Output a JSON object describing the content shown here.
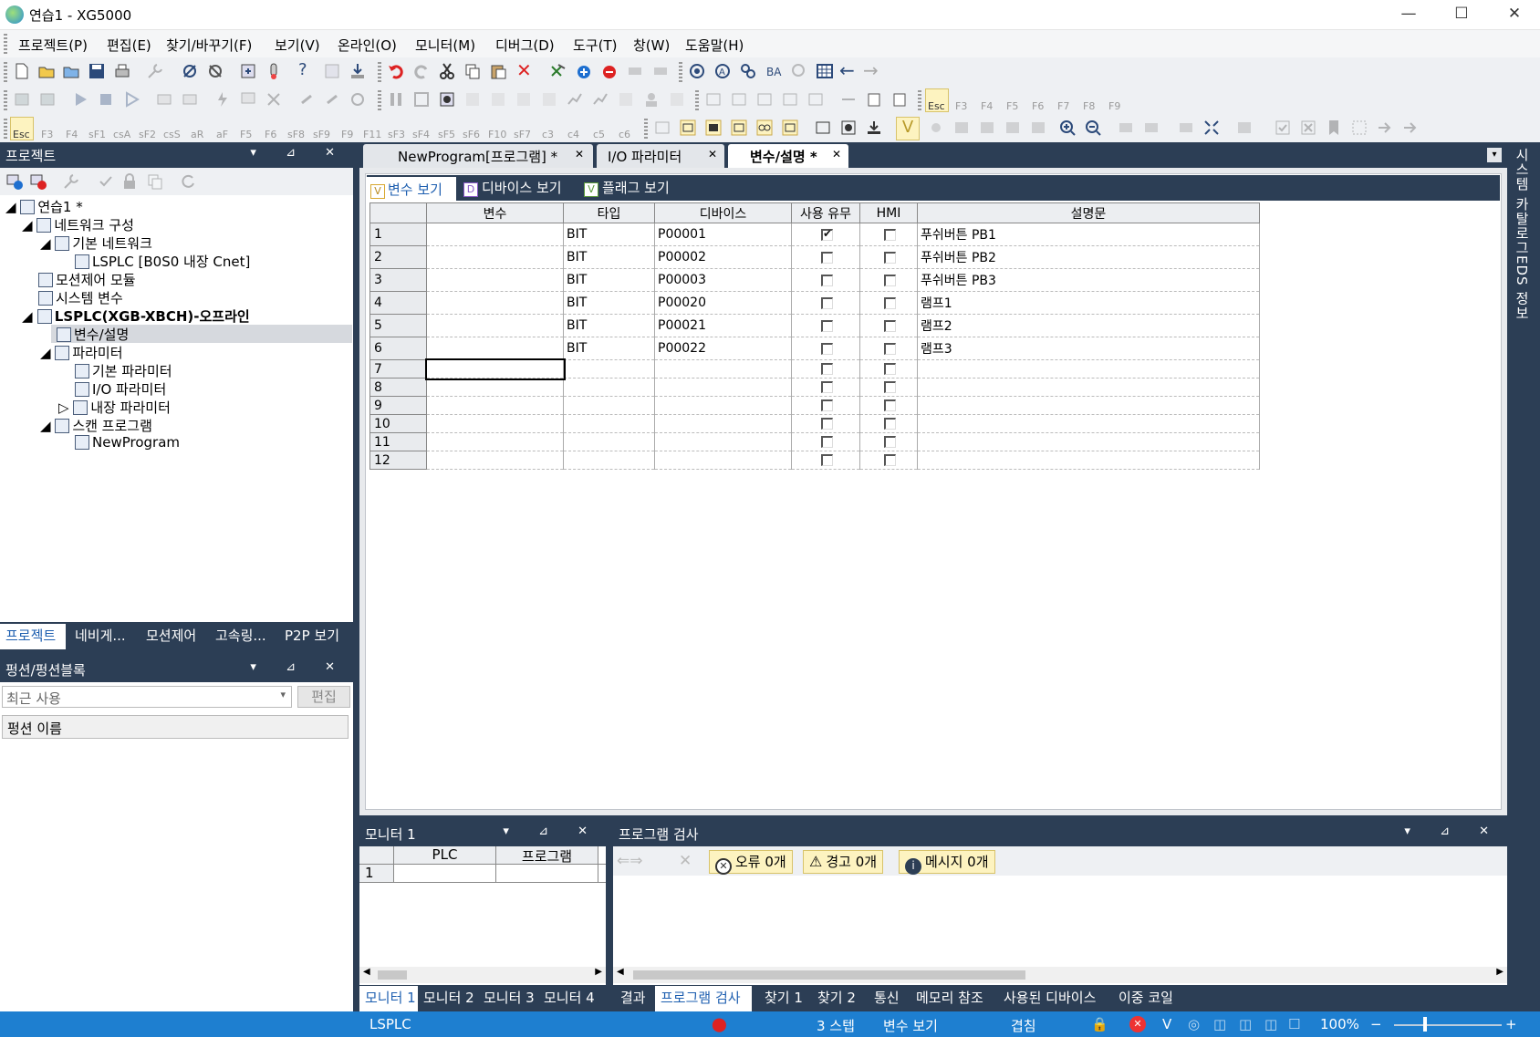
{
  "window": {
    "title": "연습1 - XG5000"
  },
  "menu": [
    "프로젝트(P)",
    "편집(E)",
    "찾기/바꾸기(F)",
    "보기(V)",
    "온라인(O)",
    "모니터(M)",
    "디버그(D)",
    "도구(T)",
    "창(W)",
    "도움말(H)"
  ],
  "toolbar": {
    "fkeys_row2": [
      "Esc",
      "F3",
      "F4",
      "F5",
      "F6",
      "F7",
      "F8",
      "F9"
    ],
    "fkeys_row3": [
      "Esc",
      "F3",
      "F4",
      "sF1",
      "csA",
      "sF2",
      "csS",
      "aR",
      "aF",
      "F5",
      "F6",
      "sF8",
      "sF9",
      "F9",
      "F11",
      "sF3",
      "sF4",
      "sF5",
      "sF6",
      "F10",
      "sF7",
      "c3",
      "c4",
      "c5",
      "c6"
    ]
  },
  "project_panel": {
    "title": "프로젝트",
    "tree": {
      "root": "연습1 *",
      "network": "네트워크 구성",
      "basic_network": "기본 네트워크",
      "cnet": "LSPLC [B0S0 내장 Cnet]",
      "motion": "모션제어 모듈",
      "system_vars": "시스템 변수",
      "plc": "LSPLC(XGB-XBCH)-오프라인",
      "vars": "변수/설명",
      "params": "파라미터",
      "basic_param": "기본 파라미터",
      "io_param": "I/O 파라미터",
      "builtin_param": "내장 파라미터",
      "scan_program": "스캔 프로그램",
      "new_program": "NewProgram"
    },
    "tabs": [
      "프로젝트",
      "네비게...",
      "모션제어",
      "고속링...",
      "P2P 보기"
    ]
  },
  "function_panel": {
    "title": "펑션/펑션블록",
    "combo_value": "최근 사용",
    "edit_button": "편집",
    "column": "펑션 이름"
  },
  "doc_tabs": [
    "NewProgram[프로그램] *",
    "I/O 파라미터",
    "변수/설명 *"
  ],
  "view_tabs": [
    "변수 보기",
    "디바이스 보기",
    "플래그 보기"
  ],
  "var_table": {
    "headers": [
      "변수",
      "타입",
      "디바이스",
      "사용 유무",
      "HMI",
      "설명문"
    ],
    "rows": [
      {
        "n": "1",
        "var": "",
        "type": "BIT",
        "device": "P00001",
        "used": true,
        "hmi": false,
        "desc": "푸쉬버튼 PB1"
      },
      {
        "n": "2",
        "var": "",
        "type": "BIT",
        "device": "P00002",
        "used": false,
        "hmi": false,
        "desc": "푸쉬버튼 PB2"
      },
      {
        "n": "3",
        "var": "",
        "type": "BIT",
        "device": "P00003",
        "used": false,
        "hmi": false,
        "desc": "푸쉬버튼 PB3"
      },
      {
        "n": "4",
        "var": "",
        "type": "BIT",
        "device": "P00020",
        "used": false,
        "hmi": false,
        "desc": "램프1"
      },
      {
        "n": "5",
        "var": "",
        "type": "BIT",
        "device": "P00021",
        "used": false,
        "hmi": false,
        "desc": "램프2"
      },
      {
        "n": "6",
        "var": "",
        "type": "BIT",
        "device": "P00022",
        "used": false,
        "hmi": false,
        "desc": "램프3"
      },
      {
        "n": "7",
        "var": "",
        "type": "",
        "device": "",
        "used": false,
        "hmi": false,
        "desc": ""
      },
      {
        "n": "8",
        "var": "",
        "type": "",
        "device": "",
        "used": false,
        "hmi": false,
        "desc": ""
      },
      {
        "n": "9",
        "var": "",
        "type": "",
        "device": "",
        "used": false,
        "hmi": false,
        "desc": ""
      },
      {
        "n": "10",
        "var": "",
        "type": "",
        "device": "",
        "used": false,
        "hmi": false,
        "desc": ""
      },
      {
        "n": "11",
        "var": "",
        "type": "",
        "device": "",
        "used": false,
        "hmi": false,
        "desc": ""
      },
      {
        "n": "12",
        "var": "",
        "type": "",
        "device": "",
        "used": false,
        "hmi": false,
        "desc": ""
      }
    ]
  },
  "side_tabs": [
    "시스템 카탈로그",
    "EDS 정보"
  ],
  "monitor_panel": {
    "title": "모니터 1",
    "headers": [
      "PLC",
      "프로그램"
    ],
    "row": "1",
    "tabs": [
      "모니터 1",
      "모니터 2",
      "모니터 3",
      "모니터 4"
    ]
  },
  "check_panel": {
    "title": "프로그램 검사",
    "errors": "오류 0개",
    "warnings": "경고 0개",
    "messages": "메시지 0개",
    "tabs": [
      "결과",
      "프로그램 검사",
      "찾기 1",
      "찾기 2",
      "통신",
      "메모리 참조",
      "사용된 디바이스",
      "이중 코일"
    ]
  },
  "status": {
    "plc": "LSPLC",
    "steps": "3 스텝",
    "view": "변수 보기",
    "mode": "겹침",
    "zoom": "100%"
  },
  "colors": {
    "accent": "#1e7fd0",
    "frame": "#2c3e55",
    "chip": "#fdf3c0"
  }
}
